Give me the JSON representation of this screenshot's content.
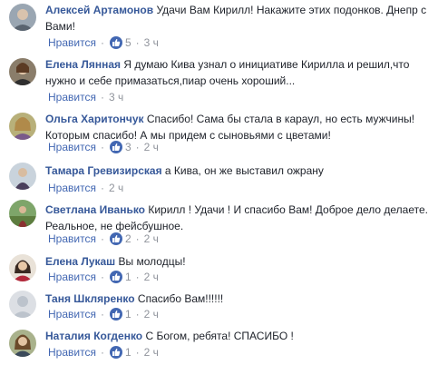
{
  "like_label": "Нравится",
  "reaction_icon": "thumbs-up-icon",
  "colors": {
    "author": "#365899",
    "meta": "#90949c",
    "like": "#4267b2"
  },
  "comments": [
    {
      "author": "Алексей Артамонов",
      "text": "Удачи Вам Кирилл! Накажите этих подонков. Днепр с Вами!",
      "likes": "5",
      "time": "3 ч"
    },
    {
      "author": "Елена Лянная",
      "text": "Я думаю Кива узнал о инициативе Кирилла и решил,что нужно и себе примазаться,пиар очень хороший...",
      "likes": "",
      "time": "3 ч"
    },
    {
      "author": "Ольга Харитончук",
      "text": "Спасибо! Сама бы стала в караул, но есть мужчины! Которым спасибо! А мы придем с сыновьями с цветами!",
      "likes": "3",
      "time": "2 ч"
    },
    {
      "author": "Тамара Гревизирская",
      "text": "а Кива, он же выставил ожрану",
      "likes": "",
      "time": "2 ч"
    },
    {
      "author": "Светлана Иванько",
      "text": "Кирилл ! Удачи ! И спасибо Вам! Доброе дело делаете. Реальное, не фейсбушное.",
      "likes": "2",
      "time": "2 ч"
    },
    {
      "author": "Елена Лукаш",
      "text": "Вы молодцы!",
      "likes": "1",
      "time": "2 ч"
    },
    {
      "author": "Таня Шкляренко",
      "text": "Спасибо Вам!!!!!!",
      "likes": "1",
      "time": "2 ч"
    },
    {
      "author": "Наталия Когденко",
      "text": "С Богом, ребята! СПАСИБО !",
      "likes": "1",
      "time": "2 ч"
    }
  ]
}
